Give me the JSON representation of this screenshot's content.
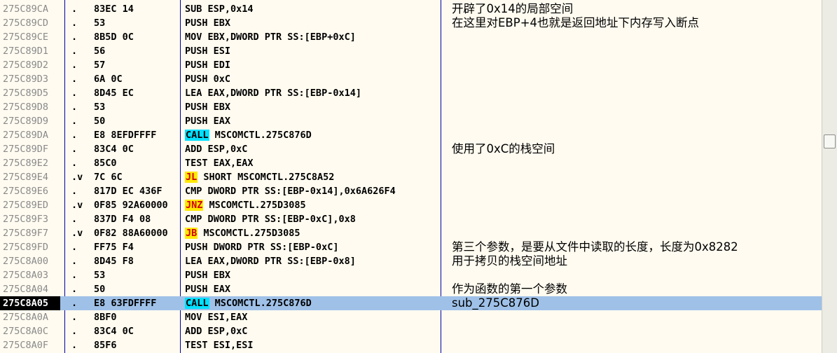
{
  "rows": [
    {
      "addr": "275C89CA",
      "mark": ".",
      "hex": "83EC 14",
      "pre": "",
      "op": "",
      "op_type": "",
      "post": "SUB ESP,0x14",
      "comment": "开辟了0x14的局部空间",
      "sel": false
    },
    {
      "addr": "275C89CD",
      "mark": ".",
      "hex": "53",
      "pre": "",
      "op": "",
      "op_type": "",
      "post": "PUSH EBX",
      "comment": "在这里对EBP+4也就是返回地址下内存写入断点",
      "sel": false
    },
    {
      "addr": "275C89CE",
      "mark": ".",
      "hex": "8B5D 0C",
      "pre": "",
      "op": "",
      "op_type": "",
      "post": "MOV EBX,DWORD PTR SS:[EBP+0xC]",
      "comment": "",
      "sel": false
    },
    {
      "addr": "275C89D1",
      "mark": ".",
      "hex": "56",
      "pre": "",
      "op": "",
      "op_type": "",
      "post": "PUSH ESI",
      "comment": "",
      "sel": false
    },
    {
      "addr": "275C89D2",
      "mark": ".",
      "hex": "57",
      "pre": "",
      "op": "",
      "op_type": "",
      "post": "PUSH EDI",
      "comment": "",
      "sel": false
    },
    {
      "addr": "275C89D3",
      "mark": ".",
      "hex": "6A 0C",
      "pre": "",
      "op": "",
      "op_type": "",
      "post": "PUSH 0xC",
      "comment": "",
      "sel": false
    },
    {
      "addr": "275C89D5",
      "mark": ".",
      "hex": "8D45 EC",
      "pre": "",
      "op": "",
      "op_type": "",
      "post": "LEA EAX,DWORD PTR SS:[EBP-0x14]",
      "comment": "",
      "sel": false
    },
    {
      "addr": "275C89D8",
      "mark": ".",
      "hex": "53",
      "pre": "",
      "op": "",
      "op_type": "",
      "post": "PUSH EBX",
      "comment": "",
      "sel": false
    },
    {
      "addr": "275C89D9",
      "mark": ".",
      "hex": "50",
      "pre": "",
      "op": "",
      "op_type": "",
      "post": "PUSH EAX",
      "comment": "",
      "sel": false
    },
    {
      "addr": "275C89DA",
      "mark": ".",
      "hex": "E8 8EFDFFFF",
      "pre": "",
      "op": "CALL",
      "op_type": "call",
      "post": " MSCOMCTL.275C876D",
      "comment": "",
      "sel": false
    },
    {
      "addr": "275C89DF",
      "mark": ".",
      "hex": "83C4 0C",
      "pre": "",
      "op": "",
      "op_type": "",
      "post": "ADD ESP,0xC",
      "comment": "使用了0xC的栈空间",
      "sel": false
    },
    {
      "addr": "275C89E2",
      "mark": ".",
      "hex": "85C0",
      "pre": "",
      "op": "",
      "op_type": "",
      "post": "TEST EAX,EAX",
      "comment": "",
      "sel": false
    },
    {
      "addr": "275C89E4",
      "mark": ".v",
      "hex": "7C 6C",
      "pre": "",
      "op": "JL",
      "op_type": "jmp",
      "post": " SHORT MSCOMCTL.275C8A52",
      "comment": "",
      "sel": false
    },
    {
      "addr": "275C89E6",
      "mark": ".",
      "hex": "817D EC 436F",
      "pre": "",
      "op": "",
      "op_type": "",
      "post": "CMP DWORD PTR SS:[EBP-0x14],0x6A626F4",
      "comment": "",
      "sel": false
    },
    {
      "addr": "275C89ED",
      "mark": ".v",
      "hex": "0F85 92A60000",
      "pre": "",
      "op": "JNZ",
      "op_type": "jmp",
      "post": " MSCOMCTL.275D3085",
      "comment": "",
      "sel": false
    },
    {
      "addr": "275C89F3",
      "mark": ".",
      "hex": "837D F4 08",
      "pre": "",
      "op": "",
      "op_type": "",
      "post": "CMP DWORD PTR SS:[EBP-0xC],0x8",
      "comment": "",
      "sel": false
    },
    {
      "addr": "275C89F7",
      "mark": ".v",
      "hex": "0F82 88A60000",
      "pre": "",
      "op": "JB",
      "op_type": "jmp",
      "post": " MSCOMCTL.275D3085",
      "comment": "",
      "sel": false
    },
    {
      "addr": "275C89FD",
      "mark": ".",
      "hex": "FF75 F4",
      "pre": "",
      "op": "",
      "op_type": "",
      "post": "PUSH DWORD PTR SS:[EBP-0xC]",
      "comment": "第三个参数，是要从文件中读取的长度，长度为0x8282",
      "sel": false
    },
    {
      "addr": "275C8A00",
      "mark": ".",
      "hex": "8D45 F8",
      "pre": "",
      "op": "",
      "op_type": "",
      "post": "LEA EAX,DWORD PTR SS:[EBP-0x8]",
      "comment": "用于拷贝的栈空间地址",
      "sel": false
    },
    {
      "addr": "275C8A03",
      "mark": ".",
      "hex": "53",
      "pre": "",
      "op": "",
      "op_type": "",
      "post": "PUSH EBX",
      "comment": "",
      "sel": false
    },
    {
      "addr": "275C8A04",
      "mark": ".",
      "hex": "50",
      "pre": "",
      "op": "",
      "op_type": "",
      "post": "PUSH EAX",
      "comment": "作为函数的第一个参数",
      "sel": false
    },
    {
      "addr": "275C8A05",
      "mark": ".",
      "hex": "E8 63FDFFFF",
      "pre": "",
      "op": "CALL",
      "op_type": "call",
      "post": " MSCOMCTL.275C876D",
      "comment": "sub_275C876D",
      "sel": true
    },
    {
      "addr": "275C8A0A",
      "mark": ".",
      "hex": "8BF0",
      "pre": "",
      "op": "",
      "op_type": "",
      "post": "MOV ESI,EAX",
      "comment": "",
      "sel": false
    },
    {
      "addr": "275C8A0C",
      "mark": ".",
      "hex": "83C4 0C",
      "pre": "",
      "op": "",
      "op_type": "",
      "post": "ADD ESP,0xC",
      "comment": "",
      "sel": false
    },
    {
      "addr": "275C8A0F",
      "mark": ".",
      "hex": "85F6",
      "pre": "",
      "op": "",
      "op_type": "",
      "post": "TEST ESI,ESI",
      "comment": "",
      "sel": false
    }
  ],
  "colors": {
    "background": "#fffbf0",
    "selection": "#9fc1e8",
    "call_highlight": "#00e0ff",
    "jump_highlight": "#ffea00",
    "jump_text": "#d00000",
    "column_line": "#0000a0"
  }
}
